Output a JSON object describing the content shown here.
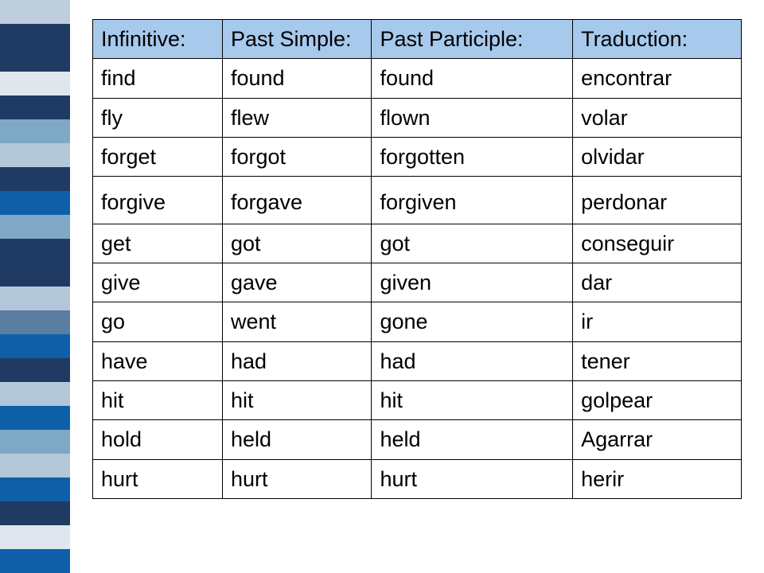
{
  "sidebar_colors": [
    "#bfcedb",
    "#1f3b63",
    "#1f3b63",
    "#dfe6ee",
    "#1f3b63",
    "#7fa8c7",
    "#b3c7d9",
    "#1f3b63",
    "#0f5fa8",
    "#7fa8c7",
    "#1f3b63",
    "#1f3b63",
    "#b3c7d9",
    "#5a7ea1",
    "#0f5fa8",
    "#1f3b63",
    "#b3c7d9",
    "#0f5fa8",
    "#7fa8c7",
    "#b3c7d9",
    "#0f5fa8",
    "#1f3b63",
    "#dfe6ee",
    "#0f5fa8"
  ],
  "headers": {
    "infinitive": "Infinitive:",
    "past_simple": "Past Simple:",
    "past_participle": "Past Participle:",
    "traduction": "Traduction:"
  },
  "chart_data": {
    "type": "table",
    "title": "",
    "columns": [
      "Infinitive",
      "Past Simple",
      "Past Participle",
      "Traduction"
    ],
    "rows": [
      {
        "infinitive": "find",
        "past_simple": "found",
        "past_participle": "found",
        "traduction": "encontrar"
      },
      {
        "infinitive": "fly",
        "past_simple": "flew",
        "past_participle": "flown",
        "traduction": "volar"
      },
      {
        "infinitive": "forget",
        "past_simple": "forgot",
        "past_participle": "forgotten",
        "traduction": "olvidar"
      },
      {
        "infinitive": "forgive",
        "past_simple": "forgave",
        "past_participle": "forgiven",
        "traduction": "perdonar"
      },
      {
        "infinitive": "get",
        "past_simple": "got",
        "past_participle": "got",
        "traduction": "conseguir"
      },
      {
        "infinitive": "give",
        "past_simple": "gave",
        "past_participle": "given",
        "traduction": "dar"
      },
      {
        "infinitive": "go",
        "past_simple": "went",
        "past_participle": "gone",
        "traduction": "ir"
      },
      {
        "infinitive": "have",
        "past_simple": "had",
        "past_participle": "had",
        "traduction": "tener"
      },
      {
        "infinitive": "hit",
        "past_simple": "hit",
        "past_participle": "hit",
        "traduction": "golpear"
      },
      {
        "infinitive": "hold",
        "past_simple": "held",
        "past_participle": "held",
        "traduction": "Agarrar"
      },
      {
        "infinitive": "hurt",
        "past_simple": "hurt",
        "past_participle": "hurt",
        "traduction": "herir"
      }
    ]
  }
}
